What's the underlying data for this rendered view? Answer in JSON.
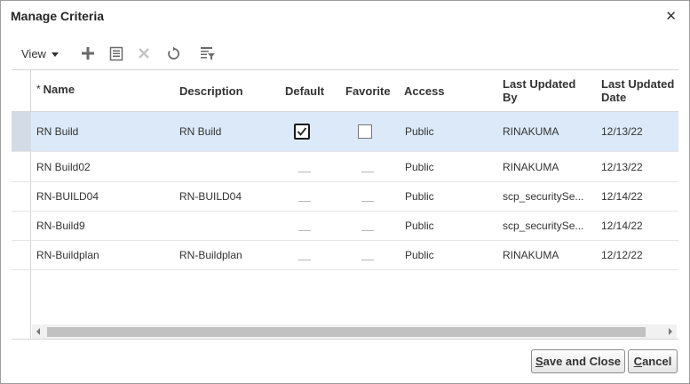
{
  "dialog": {
    "title": "Manage Criteria",
    "close_glyph": "✕"
  },
  "toolbar": {
    "view_label": "View",
    "icons": [
      "add-icon",
      "details-icon",
      "delete-icon",
      "refresh-icon",
      "filter-icon"
    ]
  },
  "table": {
    "columns": [
      {
        "label": "Name",
        "required": true
      },
      {
        "label": "Description"
      },
      {
        "label": "Default"
      },
      {
        "label": "Favorite"
      },
      {
        "label": "Access"
      },
      {
        "label": "Last Updated By"
      },
      {
        "label": "Last Updated Date"
      }
    ],
    "rows": [
      {
        "name": "RN Build",
        "description": "RN Build",
        "default": true,
        "favorite": false,
        "access": "Public",
        "updated_by": "RINAKUMA",
        "updated_date": "12/13/22",
        "selected": true
      },
      {
        "name": "RN Build02",
        "description": "",
        "default": null,
        "favorite": null,
        "access": "Public",
        "updated_by": "RINAKUMA",
        "updated_date": "12/13/22"
      },
      {
        "name": "RN-BUILD04",
        "description": "RN-BUILD04",
        "default": null,
        "favorite": null,
        "access": "Public",
        "updated_by": "scp_securitySe...",
        "updated_date": "12/14/22"
      },
      {
        "name": "RN-Build9",
        "description": "",
        "default": null,
        "favorite": null,
        "access": "Public",
        "updated_by": "scp_securitySe...",
        "updated_date": "12/14/22"
      },
      {
        "name": "RN-Buildplan",
        "description": "RN-Buildplan",
        "default": null,
        "favorite": null,
        "access": "Public",
        "updated_by": "RINAKUMA",
        "updated_date": "12/12/22"
      }
    ]
  },
  "footer": {
    "save_underline": "S",
    "save_rest": "ave and Close",
    "cancel_underline": "C",
    "cancel_rest": "ancel"
  },
  "colors": {
    "selected_row": "#dbe9f8",
    "border": "#d6d6d6"
  }
}
